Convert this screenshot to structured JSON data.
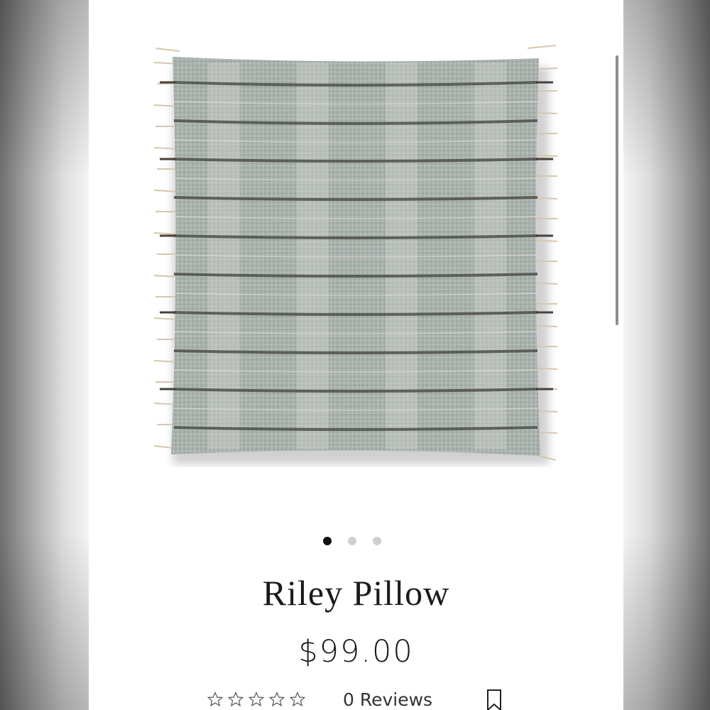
{
  "product": {
    "title": "Riley Pillow",
    "price": "$99.00",
    "reviews_label": "0 Reviews",
    "rating": 0,
    "rating_max": 5
  },
  "gallery": {
    "image_count": 3,
    "active_index": 0
  },
  "icons": {
    "rating": "star-outline-icon",
    "save": "bookmark-icon"
  },
  "colors": {
    "text": "#1a1a1a",
    "dot_active": "#111111",
    "dot_inactive": "#cfcfcf",
    "pillow_base": "#a9b2ad",
    "pillow_stripe": "#4f504d",
    "fringe": "#d8c7ad"
  }
}
